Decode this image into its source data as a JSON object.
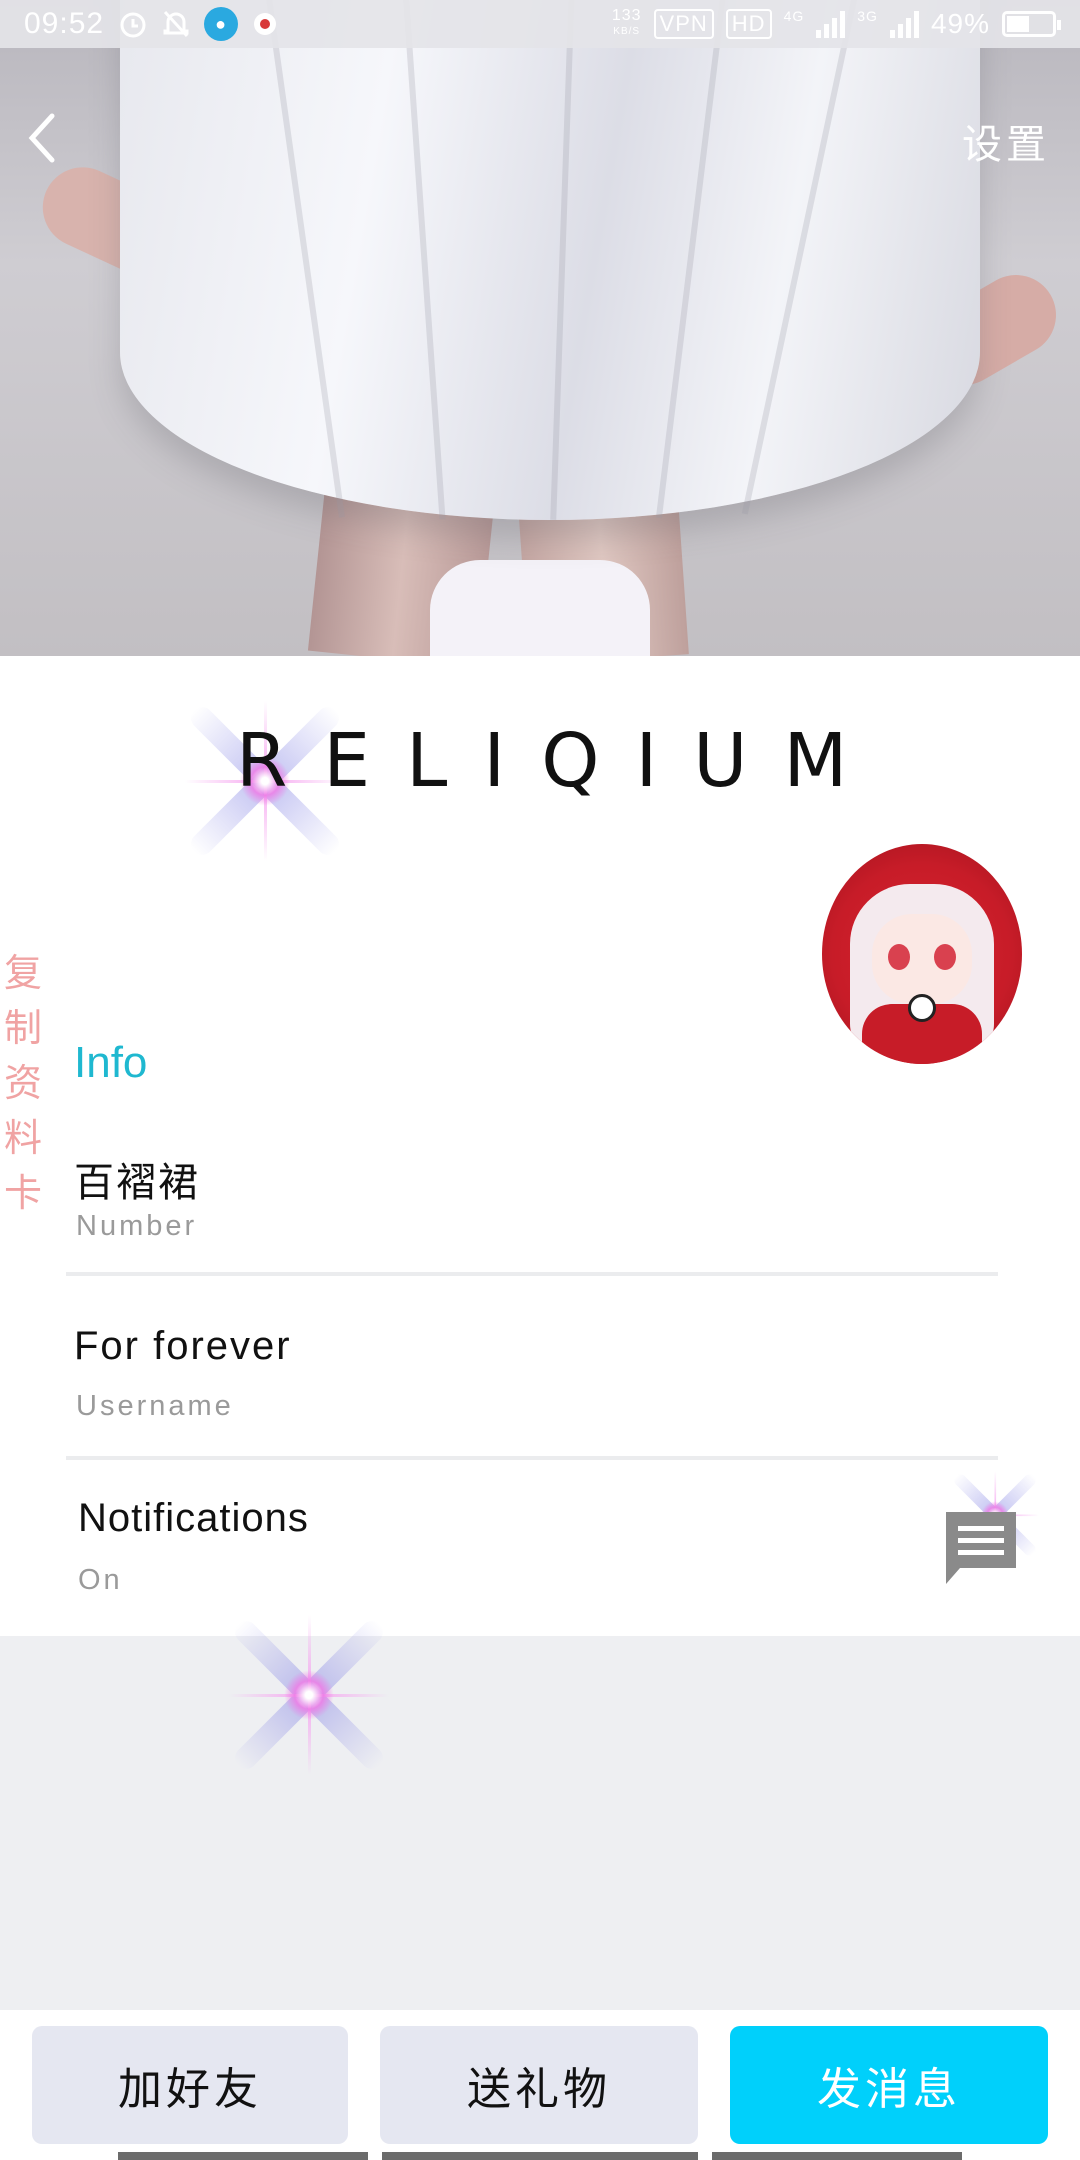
{
  "status_bar": {
    "time": "09:52",
    "net_speed_value": "133",
    "net_speed_unit": "KB/S",
    "vpn": "VPN",
    "hd": "HD",
    "network_4g": "4G",
    "network_3g": "3G",
    "battery": "49%",
    "battery_level": 0.49
  },
  "nav": {
    "settings_label": "设置"
  },
  "logo": {
    "text": "RELIQIUM"
  },
  "side_action": {
    "chars": [
      "复",
      "制",
      "资",
      "料",
      "卡"
    ]
  },
  "info": {
    "title": "Info",
    "fields": [
      {
        "value": "百褶裙",
        "label": "Number"
      },
      {
        "value": "For forever",
        "label": "Username"
      },
      {
        "value": "Notifications",
        "label": "On"
      }
    ]
  },
  "actions": {
    "add_friend": "加好友",
    "send_gift": "送礼物",
    "send_message": "发消息"
  },
  "colors": {
    "accent_cyan": "#00d0fb",
    "info_title": "#1fb8d0",
    "side_copy": "#f0a3a3"
  }
}
